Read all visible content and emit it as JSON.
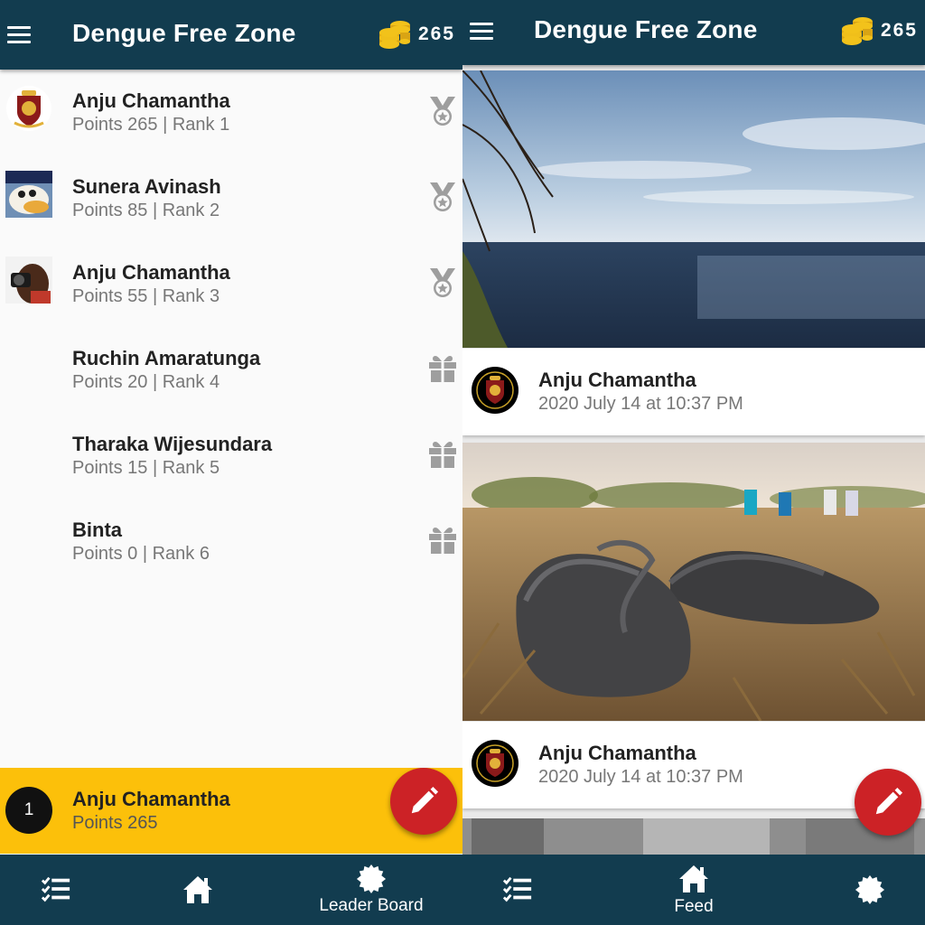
{
  "app": {
    "title": "Dengue Free Zone",
    "coin_count": "265"
  },
  "leaderboard": {
    "entries": [
      {
        "name": "Anju Chamantha",
        "meta": "Points 265 | Rank 1",
        "icon": "medal-icon"
      },
      {
        "name": "Sunera Avinash",
        "meta": "Points 85 | Rank 2",
        "icon": "medal-icon"
      },
      {
        "name": "Anju Chamantha",
        "meta": "Points 55 | Rank 3",
        "icon": "medal-icon"
      },
      {
        "name": "Ruchin Amaratunga",
        "meta": "Points 20 | Rank 4",
        "icon": "gift-icon"
      },
      {
        "name": "Tharaka Wijesundara",
        "meta": "Points 15 | Rank 5",
        "icon": "gift-icon"
      },
      {
        "name": "Binta",
        "meta": "Points 0 | Rank 6",
        "icon": "gift-icon"
      }
    ],
    "current_user": {
      "rank": "1",
      "name": "Anju Chamantha",
      "points": "Points 265"
    }
  },
  "feed": {
    "posts": [
      {
        "author": "Anju Chamantha",
        "time": "2020 July 14 at 10:37 PM",
        "image": "sea-and-sky-photo"
      },
      {
        "author": "Anju Chamantha",
        "time": "2020 July 14 at 10:37 PM",
        "image": "slippers-on-grass-photo"
      }
    ]
  },
  "nav_left": {
    "tasks_icon": "checklist-icon",
    "home_icon": "home-icon",
    "leaderboard_icon": "badge-icon",
    "active_label": "Leader Board"
  },
  "nav_right": {
    "tasks_icon": "checklist-icon",
    "home_icon": "home-icon",
    "leaderboard_icon": "badge-icon",
    "active_label": "Feed"
  },
  "colors": {
    "app_bar": "#123c4f",
    "highlight": "#fcc00a",
    "fab": "#cc2226",
    "coin": "#f2c21b"
  }
}
